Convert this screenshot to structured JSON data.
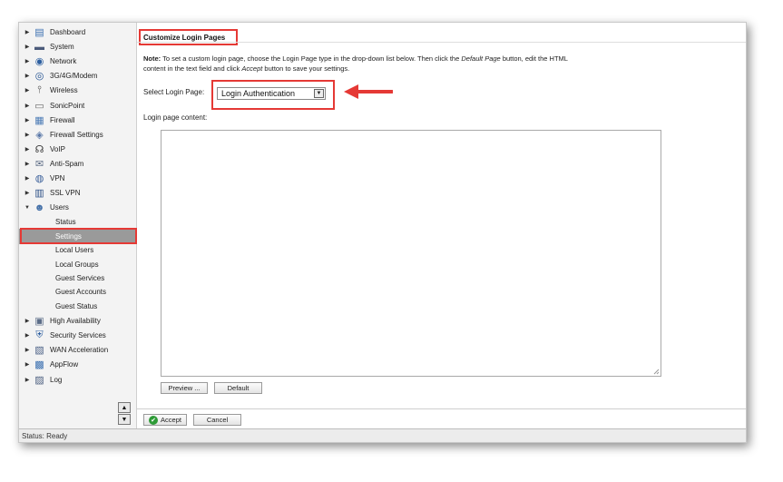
{
  "sidebar": {
    "items": [
      {
        "label": "Dashboard",
        "icon": "dashboard-icon",
        "expanded": false
      },
      {
        "label": "System",
        "icon": "system-icon",
        "expanded": false
      },
      {
        "label": "Network",
        "icon": "network-icon",
        "expanded": false
      },
      {
        "label": "3G/4G/Modem",
        "icon": "modem-icon",
        "expanded": false
      },
      {
        "label": "Wireless",
        "icon": "wireless-icon",
        "expanded": false
      },
      {
        "label": "SonicPoint",
        "icon": "sonicpoint-icon",
        "expanded": false
      },
      {
        "label": "Firewall",
        "icon": "firewall-icon",
        "expanded": false
      },
      {
        "label": "Firewall Settings",
        "icon": "firewall-settings-icon",
        "expanded": false
      },
      {
        "label": "VoIP",
        "icon": "voip-icon",
        "expanded": false
      },
      {
        "label": "Anti-Spam",
        "icon": "anti-spam-icon",
        "expanded": false
      },
      {
        "label": "VPN",
        "icon": "vpn-icon",
        "expanded": false
      },
      {
        "label": "SSL VPN",
        "icon": "ssl-vpn-icon",
        "expanded": false
      },
      {
        "label": "Users",
        "icon": "users-icon",
        "expanded": true
      },
      {
        "label": "High Availability",
        "icon": "high-availability-icon",
        "expanded": false
      },
      {
        "label": "Security Services",
        "icon": "security-services-icon",
        "expanded": false
      },
      {
        "label": "WAN Acceleration",
        "icon": "wan-acceleration-icon",
        "expanded": false
      },
      {
        "label": "AppFlow",
        "icon": "appflow-icon",
        "expanded": false
      },
      {
        "label": "Log",
        "icon": "log-icon",
        "expanded": false
      }
    ],
    "users_subitems": [
      {
        "label": "Status",
        "active": false
      },
      {
        "label": "Settings",
        "active": true
      },
      {
        "label": "Local Users",
        "active": false
      },
      {
        "label": "Local Groups",
        "active": false
      },
      {
        "label": "Guest Services",
        "active": false
      },
      {
        "label": "Guest Accounts",
        "active": false
      },
      {
        "label": "Guest Status",
        "active": false
      }
    ]
  },
  "main": {
    "title": "Customize Login Pages",
    "note": {
      "bold": "Note:",
      "part1": " To set a custom login page, choose the Login Page type in the drop-down list below. Then click the ",
      "italic1": "Default Page",
      "part2": " button, edit the HTML content in the text field and click ",
      "italic2": "Accept",
      "part3": " button to save your settings."
    },
    "select_label": "Select Login Page:",
    "select_value": "Login Authentication",
    "content_label": "Login page content:",
    "content_value": "",
    "preview_label": "Preview ...",
    "default_label": "Default",
    "accept_label": "Accept",
    "cancel_label": "Cancel"
  },
  "status": "Status: Ready",
  "colors": {
    "highlight": "#e53935",
    "active_item": "#9a9a9a",
    "accept_icon": "#2e9b37"
  }
}
